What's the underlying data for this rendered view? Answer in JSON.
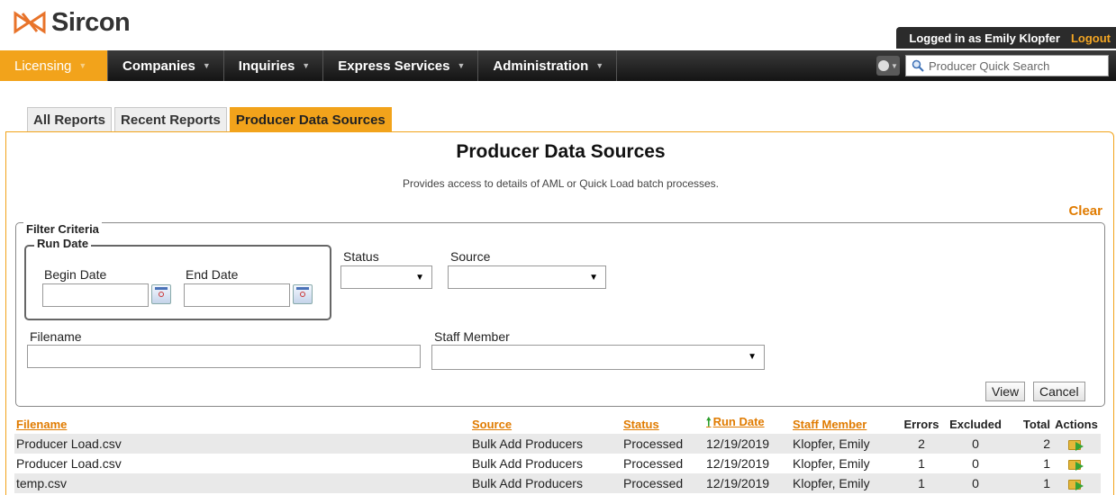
{
  "brand": {
    "name": "Sircon",
    "logo_color": "#e8732a"
  },
  "user_bar": {
    "logged_in_text": "Logged in as Emily Klopfer",
    "logout_label": "Logout"
  },
  "nav": {
    "items": [
      {
        "label": "Licensing",
        "active": true
      },
      {
        "label": "Companies"
      },
      {
        "label": "Inquiries"
      },
      {
        "label": "Express Services"
      },
      {
        "label": "Administration"
      }
    ],
    "quick_search_placeholder": "Producer Quick Search"
  },
  "tabs": [
    {
      "label": "All Reports"
    },
    {
      "label": "Recent Reports"
    },
    {
      "label": "Producer Data Sources",
      "active": true
    }
  ],
  "page": {
    "title": "Producer Data Sources",
    "description": "Provides access to details of AML or Quick Load batch processes.",
    "clear_label": "Clear"
  },
  "filter": {
    "legend": "Filter Criteria",
    "run_date_legend": "Run Date",
    "begin_date_label": "Begin Date",
    "begin_date_value": "",
    "end_date_label": "End Date",
    "end_date_value": "",
    "status_label": "Status",
    "status_value": "",
    "source_label": "Source",
    "source_value": "",
    "filename_label": "Filename",
    "filename_value": "",
    "staff_label": "Staff Member",
    "staff_value": "",
    "view_label": "View",
    "cancel_label": "Cancel"
  },
  "results": {
    "columns": {
      "filename": "Filename",
      "source": "Source",
      "status": "Status",
      "run_date": "Run Date",
      "staff": "Staff Member",
      "errors": "Errors",
      "excluded": "Excluded",
      "total": "Total",
      "actions": "Actions"
    },
    "rows": [
      {
        "filename": "Producer Load.csv",
        "source": "Bulk Add Producers",
        "status": "Processed",
        "run_date": "12/19/2019",
        "staff": "Klopfer, Emily",
        "errors": "2",
        "excluded": "0",
        "total": "2"
      },
      {
        "filename": "Producer Load.csv",
        "source": "Bulk Add Producers",
        "status": "Processed",
        "run_date": "12/19/2019",
        "staff": "Klopfer, Emily",
        "errors": "1",
        "excluded": "0",
        "total": "1"
      },
      {
        "filename": "temp.csv",
        "source": "Bulk Add Producers",
        "status": "Processed",
        "run_date": "12/19/2019",
        "staff": "Klopfer, Emily",
        "errors": "1",
        "excluded": "0",
        "total": "1"
      }
    ]
  },
  "colors": {
    "accent": "#f2a31b",
    "link": "#e07b00",
    "nav_bg": "#1e1e1e"
  }
}
